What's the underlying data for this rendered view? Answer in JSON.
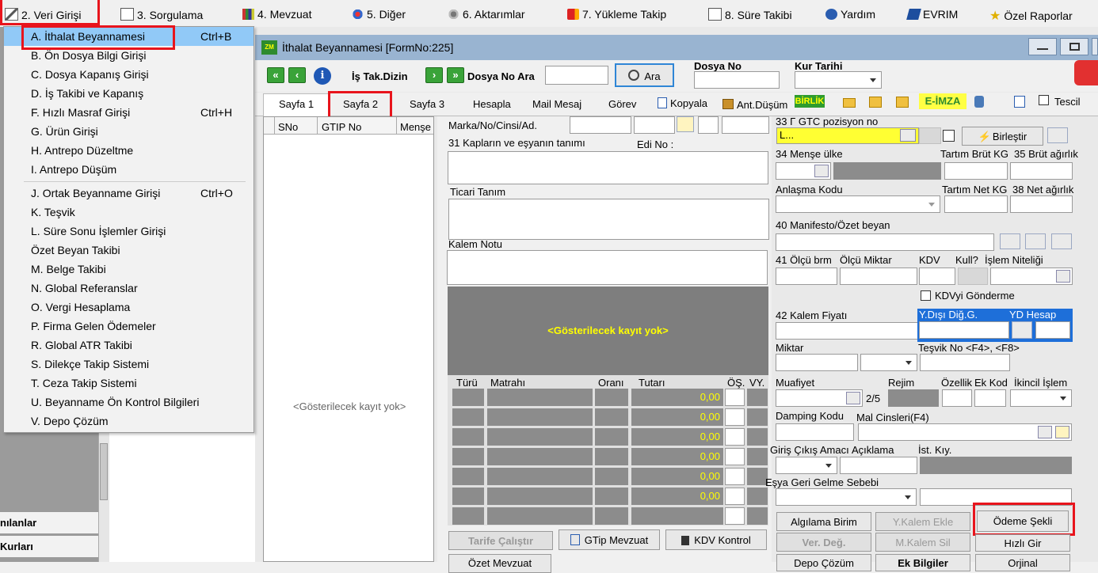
{
  "menubar": {
    "items": [
      {
        "label": "2.  Veri Girişi"
      },
      {
        "label": "3.  Sorgulama"
      },
      {
        "label": "4.  Mevzuat"
      },
      {
        "label": "5.  Diğer"
      },
      {
        "label": "6.  Aktarımlar"
      },
      {
        "label": "7.  Yükleme Takip"
      },
      {
        "label": "8. Süre Takibi"
      },
      {
        "label": "Yardım"
      },
      {
        "label": "EVRIM"
      },
      {
        "label": "Özel Raporlar"
      }
    ]
  },
  "dropdown": {
    "items": [
      {
        "label": "A.  İthalat Beyannamesi",
        "shortcut": "Ctrl+B"
      },
      {
        "label": "B.  Ön Dosya Bilgi Girişi",
        "shortcut": ""
      },
      {
        "label": "C.  Dosya Kapanış Girişi",
        "shortcut": ""
      },
      {
        "label": "D.  İş Takibi ve Kapanış",
        "shortcut": ""
      },
      {
        "label": "F.  Hızlı Masraf Girişi",
        "shortcut": "Ctrl+H"
      },
      {
        "label": "G.  Ürün Girişi",
        "shortcut": ""
      },
      {
        "label": "H.  Antrepo Düzeltme",
        "shortcut": ""
      },
      {
        "label": "I.   Antrepo Düşüm",
        "shortcut": ""
      },
      {
        "label": "J.  Ortak Beyanname Girişi",
        "shortcut": "Ctrl+O"
      },
      {
        "label": "K.  Teşvik",
        "shortcut": ""
      },
      {
        "label": "L.  Süre Sonu İşlemler Girişi",
        "shortcut": ""
      },
      {
        "label": "     Özet Beyan Takibi",
        "shortcut": ""
      },
      {
        "label": "M.   Belge Takibi",
        "shortcut": ""
      },
      {
        "label": "N.  Global Referanslar",
        "shortcut": ""
      },
      {
        "label": "O. Vergi Hesaplama",
        "shortcut": ""
      },
      {
        "label": "P. Firma Gelen Ödemeler",
        "shortcut": ""
      },
      {
        "label": "R. Global ATR Takibi",
        "shortcut": ""
      },
      {
        "label": "S. Dilekçe Takip Sistemi",
        "shortcut": ""
      },
      {
        "label": "T. Ceza Takip Sistemi",
        "shortcut": ""
      },
      {
        "label": "U. Beyanname Ön Kontrol Bilgileri",
        "shortcut": ""
      },
      {
        "label": "V. Depo Çözüm",
        "shortcut": ""
      }
    ]
  },
  "leftpanel": {
    "tab1": "nılanlar",
    "tab2": "Kurları"
  },
  "window": {
    "title": "İthalat Beyannamesi [FormNo:225]"
  },
  "toolbar": {
    "is_tak_dizin": "İş Tak.Dizin",
    "dosya_no_ara": "Dosya No Ara",
    "ara_button": "Ara",
    "dosya_no_label": "Dosya No",
    "kur_tarihi_label": "Kur Tarihi"
  },
  "tabs": {
    "sayfa1": "Sayfa 1",
    "sayfa2": "Sayfa 2",
    "sayfa3": "Sayfa 3",
    "hesapla": "Hesapla",
    "mail": "Mail Mesaj",
    "gorev": "Görev",
    "kopyala": "Kopyala",
    "antdusum": "Ant.Düşüm",
    "birlik": "BİRLİK",
    "eimza": "E-İMZA",
    "tescil": "Tescil"
  },
  "grid": {
    "headers": [
      "SNo",
      "GTIP No",
      "Menşe"
    ],
    "empty": "<Gösterilecek kayıt yok>"
  },
  "form": {
    "marka": "Marka/No/Cinsi/Ad.",
    "kaplar": "31 Kapların ve eşyanın tanımı",
    "edi": "Edi No :",
    "ticari": "Ticari Tanım",
    "kalem_notu": "Kalem Notu",
    "empty_grid": "<Gösterilecek kayıt yok>",
    "tax_headers": [
      "Türü",
      "Matrahı",
      "Oranı",
      "Tutarı",
      "ÖŞ.",
      "VY."
    ],
    "tax_values": [
      "0,00",
      "0,00",
      "0,00",
      "0,00",
      "0,00",
      "0,00"
    ],
    "gtip_label": "33 Γ GTC pozisyon no",
    "birlestir": "Birleştir",
    "mense_ulke": "34 Menşe ülke",
    "tartim_brut": "Tartım Brüt KG",
    "brut_agirlik": "35 Brüt ağırlık",
    "anlasma": "Anlaşma Kodu",
    "tartim_net": "Tartım Net KG",
    "net_agirlik": "38 Net ağırlık",
    "manifesto": "40 Manifesto/Özet beyan",
    "olcu_brm": "41 Ölçü brm",
    "olcu_miktar": "Ölçü Miktar",
    "kdv": "KDV",
    "kull": "Kull?",
    "islem_nit": "İşlem Niteliği",
    "kdvyi": "KDVyi Gönderme",
    "kalem_fiyati": "42 Kalem Fiyatı",
    "ydisi": "Y.Dışı Diğ.G.",
    "yd_hesap": "YD Hesap",
    "miktar": "Miktar",
    "tesvik": "Teşvik No <F4>, <F8>",
    "muafiyet": "Muafiyet",
    "rejim": "Rejim",
    "ozellik": "Özellik",
    "ek_kod": "Ek Kod",
    "ikincil": "İkincil İşlem",
    "muaf_count": "2/5",
    "damping": "Damping Kodu",
    "mal_cinsleri": "Mal Cinsleri(F4)",
    "giris_cikis": "Giriş Çıkış Amacı",
    "aciklama": "Açıklama",
    "ist_kiy": "İst. Kıy.",
    "esya_geri": "Eşya Geri Gelme Sebebi",
    "kalem_input": "L..."
  },
  "buttons": {
    "tarife": "Tarife Çalıştır",
    "gtip_mevzuat": "GTip Mevzuat",
    "kdv_kontrol": "KDV Kontrol",
    "ozet_mevzuat": "Özet Mevzuat",
    "algilama": "Algılama Birim",
    "ykalem": "Y.Kalem Ekle",
    "odeme": "Ödeme Şekli",
    "verdeg": "Ver. Değ.",
    "mkalem": "M.Kalem Sil",
    "hizli": "Hızlı Gir",
    "depo": "Depo Çözüm",
    "ek_bilgiler": "Ek Bilgiler",
    "orjinal": "Orjinal"
  }
}
